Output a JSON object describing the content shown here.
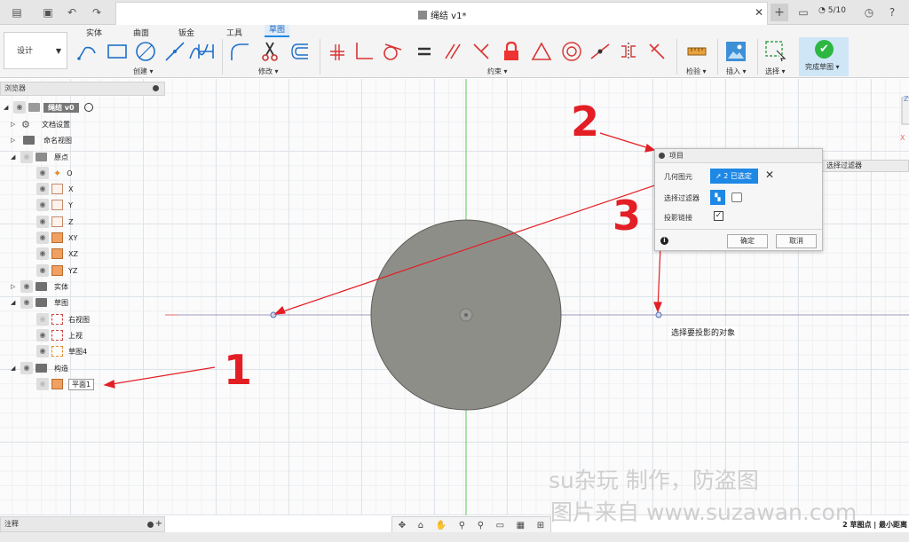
{
  "titlebar": {
    "document_title": "绳结 v1*",
    "jobs": "5/10"
  },
  "ribbon": {
    "workspace": "设计",
    "tabs": [
      "实体",
      "曲面",
      "钣金",
      "工具",
      "草图"
    ],
    "groups": {
      "create": "创建 ▾",
      "modify": "修改 ▾",
      "constraints": "约束 ▾",
      "inspect": "检验 ▾",
      "insert": "插入 ▾",
      "select": "选择 ▾",
      "finish": "完成草图 ▾"
    }
  },
  "browser": {
    "title": "浏览器",
    "nodes": [
      {
        "label": "绳结 v0"
      },
      {
        "label": "文档设置"
      },
      {
        "label": "命名视图"
      },
      {
        "label": "原点"
      },
      {
        "label": "O"
      },
      {
        "label": "X"
      },
      {
        "label": "Y"
      },
      {
        "label": "Z"
      },
      {
        "label": "XY"
      },
      {
        "label": "XZ"
      },
      {
        "label": "YZ"
      },
      {
        "label": "实体"
      },
      {
        "label": "草图"
      },
      {
        "label": "右视图"
      },
      {
        "label": "上视"
      },
      {
        "label": "草图4"
      },
      {
        "label": "构造"
      },
      {
        "label": "平面1"
      }
    ]
  },
  "dialog": {
    "title": "项目",
    "geometry_label": "几何图元",
    "geometry_value": "2 已选定",
    "filter_label": "选择过滤器",
    "chain_label": "投影链接",
    "chain_checked": true,
    "ok": "确定",
    "cancel": "取消"
  },
  "filter_panel": "选择过滤器",
  "tooltip": "选择要投影的对象",
  "comments": "注释",
  "status": "2 草图点 | 最小距离",
  "annotations": [
    "1",
    "2",
    "3"
  ],
  "watermark": {
    "line1": "su杂玩 制作，防盗图",
    "line2": "图片来自 www.suzawan.com"
  },
  "colors": {
    "accent": "#1e88e5",
    "annotation": "#e31e24",
    "x_axis": "#e86868",
    "y_axis": "#5ec85e",
    "disk": "#8e8e89",
    "finish_green": "#2db742"
  }
}
